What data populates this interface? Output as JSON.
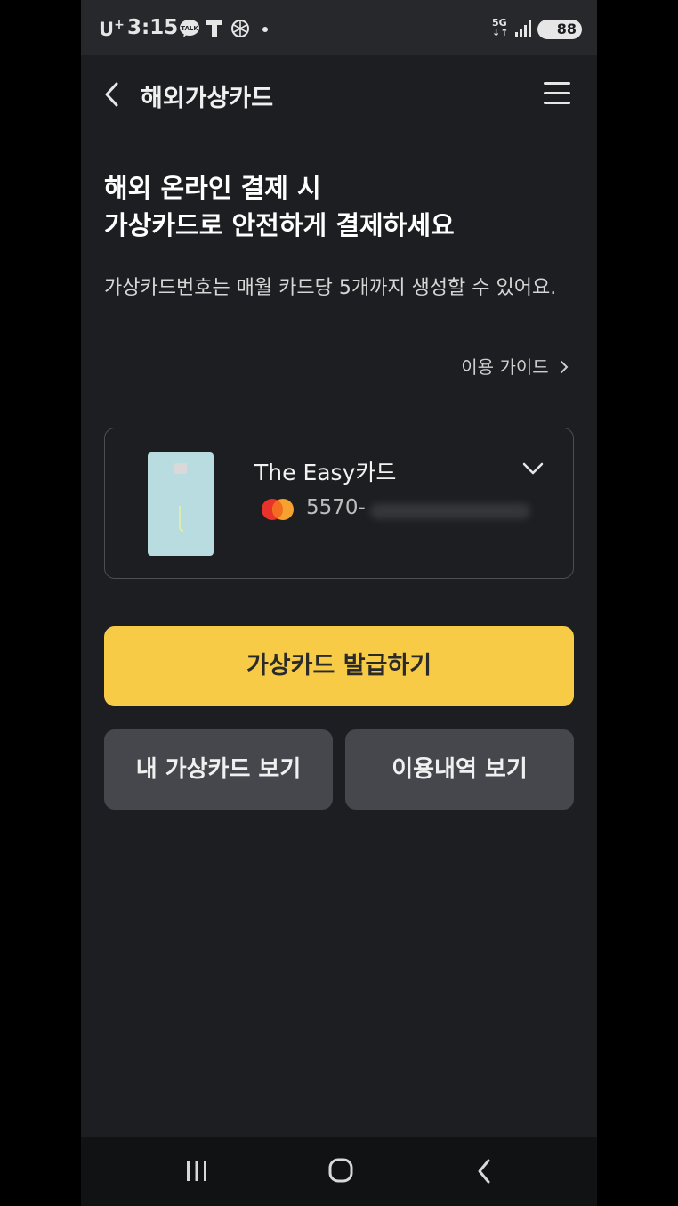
{
  "status_bar": {
    "carrier": "U",
    "carrier_sup": "+",
    "time": "3:15",
    "network": "5G",
    "battery": "88",
    "icons": [
      "talk-icon",
      "t-icon",
      "chatgpt-icon",
      "dot-icon",
      "signal-icon"
    ]
  },
  "header": {
    "title": "해외가상카드",
    "back_icon": "chevron-left-icon",
    "menu_icon": "hamburger-icon"
  },
  "headline": {
    "line1": "해외 온라인 결제 시",
    "line2": "가상카드로 안전하게 결제하세요"
  },
  "description": "가상카드번호는 매월 카드당 5개까지 생성할 수 있어요.",
  "guide_link": "이용 가이드",
  "card": {
    "name": "The Easy카드",
    "number_prefix": "5570-",
    "brand_icon": "mastercard-icon"
  },
  "buttons": {
    "issue": "가상카드 발급하기",
    "my_cards": "내 가상카드 보기",
    "history": "이용내역 보기"
  },
  "colors": {
    "background": "#1d1e21",
    "accent_yellow": "#f7cb45",
    "secondary_button": "#45474c"
  }
}
